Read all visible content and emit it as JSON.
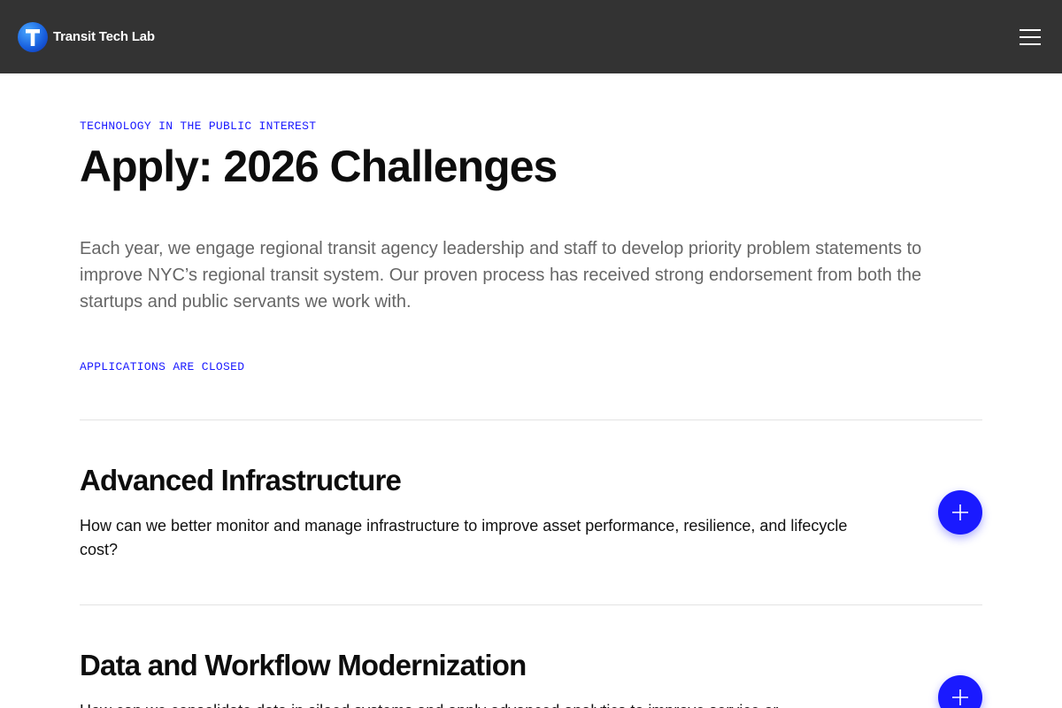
{
  "header": {
    "brand_name": "Transit Tech Lab",
    "logo_letter": "T",
    "menu_icon": "hamburger-menu-icon"
  },
  "hero": {
    "eyebrow": "TECHNOLOGY IN THE PUBLIC INTEREST",
    "title": "Apply: 2026 Challenges",
    "intro": "Each year, we engage regional transit agency leadership and staff to develop priority problem statements to improve NYC’s regional transit system. Our proven process has received strong endorsement from both the startups and public servants we work with.",
    "status": "APPLICATIONS ARE CLOSED"
  },
  "challenges": [
    {
      "title": "Advanced Infrastructure",
      "description": "How can we better monitor and manage infrastructure to improve asset performance, resilience, and lifecycle cost?",
      "expand_icon": "plus-icon"
    },
    {
      "title": "Data and Workflow Modernization",
      "description": "How can we consolidate data in siloed systems and apply advanced analytics to improve service or",
      "expand_icon": "plus-icon"
    }
  ],
  "colors": {
    "header_bg": "#333333",
    "accent": "#1a1aff",
    "body_text": "#111111",
    "muted_text": "#666666",
    "divider": "#e3e3e3"
  }
}
